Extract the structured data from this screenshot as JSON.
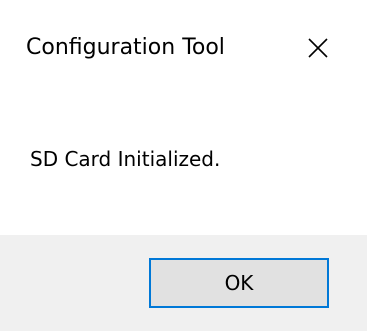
{
  "window": {
    "title": "Configuration Tool",
    "close_icon": "close-icon"
  },
  "content": {
    "message": "SD Card Initialized."
  },
  "footer": {
    "ok_label": "OK"
  },
  "colors": {
    "background": "#ffffff",
    "footer_background": "#f0f0f0",
    "button_face": "#e1e1e1",
    "button_focus_border": "#0078d7"
  }
}
